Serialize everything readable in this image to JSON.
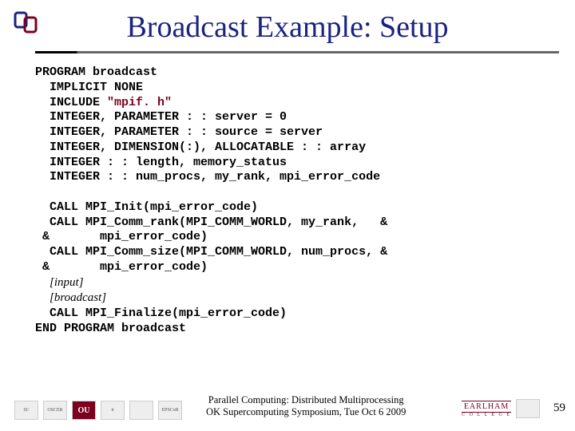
{
  "title": "Broadcast Example: Setup",
  "code": {
    "l01": "PROGRAM broadcast",
    "l02": "  IMPLICIT NONE",
    "l03a": "  INCLUDE ",
    "l03b": "\"mpif. h\"",
    "l04": "  INTEGER, PARAMETER : : server = 0",
    "l05": "  INTEGER, PARAMETER : : source = server",
    "l06": "  INTEGER, DIMENSION(:), ALLOCATABLE : : array",
    "l07": "  INTEGER : : length, memory_status",
    "l08": "  INTEGER : : num_procs, my_rank, mpi_error_code",
    "l09": "  CALL MPI_Init(mpi_error_code)",
    "l10": "  CALL MPI_Comm_rank(MPI_COMM_WORLD, my_rank,   &",
    "l11": " &       mpi_error_code)",
    "l12": "  CALL MPI_Comm_size(MPI_COMM_WORLD, num_procs, &",
    "l13": " &       mpi_error_code)",
    "p1": "[input]",
    "p2": "[broadcast]",
    "l14": "  CALL MPI_Finalize(mpi_error_code)",
    "l15": "END PROGRAM broadcast"
  },
  "footer": {
    "line1": "Parallel Computing: Distributed Multiprocessing",
    "line2": "OK Supercomputing Symposium, Tue Oct 6 2009",
    "earlham": "EARLHAM",
    "college": "C O L L E G E"
  },
  "page_number": "59",
  "logos": {
    "sc": "SC",
    "oscer": "OSCER",
    "ou": "OU",
    "it": "it",
    "epscor": "EPSCoR"
  }
}
